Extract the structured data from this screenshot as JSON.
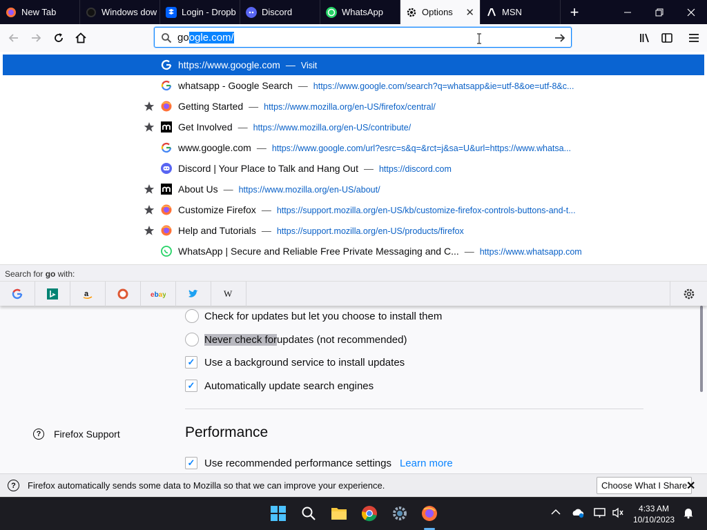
{
  "tabs": [
    {
      "label": "New Tab",
      "icon": "firefox-icon"
    },
    {
      "label": "Windows dow",
      "icon": "github-icon"
    },
    {
      "label": "Login - Dropb",
      "icon": "dropbox-icon"
    },
    {
      "label": "Discord",
      "icon": "discord-icon"
    },
    {
      "label": "WhatsApp",
      "icon": "whatsapp-icon"
    },
    {
      "label": "Options",
      "icon": "gear-icon",
      "active": true
    },
    {
      "label": "MSN",
      "icon": "msn-icon"
    }
  ],
  "new_tab_glyph": "+",
  "close_tab_glyph": "✕",
  "urlbar": {
    "typed": "go",
    "selected_completion": "ogle.com/"
  },
  "suggestions": [
    {
      "title": "https://www.google.com",
      "action": "Visit",
      "url": "",
      "icon": "google-icon",
      "starred": false,
      "highlight": true
    },
    {
      "title": "whatsapp - Google Search",
      "action": "",
      "url": "https://www.google.com/search?q=whatsapp&ie=utf-8&oe=utf-8&c...",
      "icon": "google-icon",
      "starred": false
    },
    {
      "title": "Getting Started",
      "action": "",
      "url": "https://www.mozilla.org/en-US/firefox/central/",
      "icon": "firefox-icon",
      "starred": true
    },
    {
      "title": "Get Involved",
      "action": "",
      "url": "https://www.mozilla.org/en-US/contribute/",
      "icon": "mozilla-icon",
      "starred": true
    },
    {
      "title": "www.google.com",
      "action": "",
      "url": "https://www.google.com/url?esrc=s&q=&rct=j&sa=U&url=https://www.whatsa...",
      "icon": "google-icon",
      "starred": false
    },
    {
      "title": "Discord | Your Place to Talk and Hang Out",
      "action": "",
      "url": "https://discord.com",
      "icon": "discord-icon",
      "starred": false
    },
    {
      "title": "About Us",
      "action": "",
      "url": "https://www.mozilla.org/en-US/about/",
      "icon": "mozilla-icon",
      "starred": true
    },
    {
      "title": "Customize Firefox",
      "action": "",
      "url": "https://support.mozilla.org/en-US/kb/customize-firefox-controls-buttons-and-t...",
      "icon": "firefox-icon",
      "starred": true
    },
    {
      "title": "Help and Tutorials",
      "action": "",
      "url": "https://support.mozilla.org/en-US/products/firefox",
      "icon": "firefox-icon",
      "starred": true
    },
    {
      "title": "WhatsApp | Secure and Reliable Free Private Messaging and C...",
      "action": "",
      "url": "https://www.whatsapp.com",
      "icon": "whatsapp-icon",
      "starred": false
    }
  ],
  "search_with": {
    "prefix": "Search for ",
    "term": "go",
    "suffix": " with:"
  },
  "engines": [
    "google",
    "bing",
    "amazon",
    "duckduckgo",
    "ebay",
    "twitter",
    "wikipedia"
  ],
  "options": {
    "update_choose": "Check for updates but let you choose to install them",
    "update_never_highlight": "Never check for ",
    "update_never_rest": "updates (not recommended)",
    "background_service": "Use a background service to install updates",
    "auto_update_engines": "Automatically update search engines",
    "performance_heading": "Performance",
    "recommended_perf": "Use recommended performance settings",
    "learn_more": "Learn more",
    "firefox_support": "Firefox Support"
  },
  "notification": {
    "text": "Firefox automatically sends some data to Mozilla so that we can improve your experience.",
    "button": "Choose What I Share"
  },
  "taskbar": {
    "time": "4:33 AM",
    "date": "10/10/2023"
  },
  "colors": {
    "accent": "#0a84ff",
    "highlight_row": "#0a64d2",
    "tabstrip": "#0c0c1f"
  }
}
